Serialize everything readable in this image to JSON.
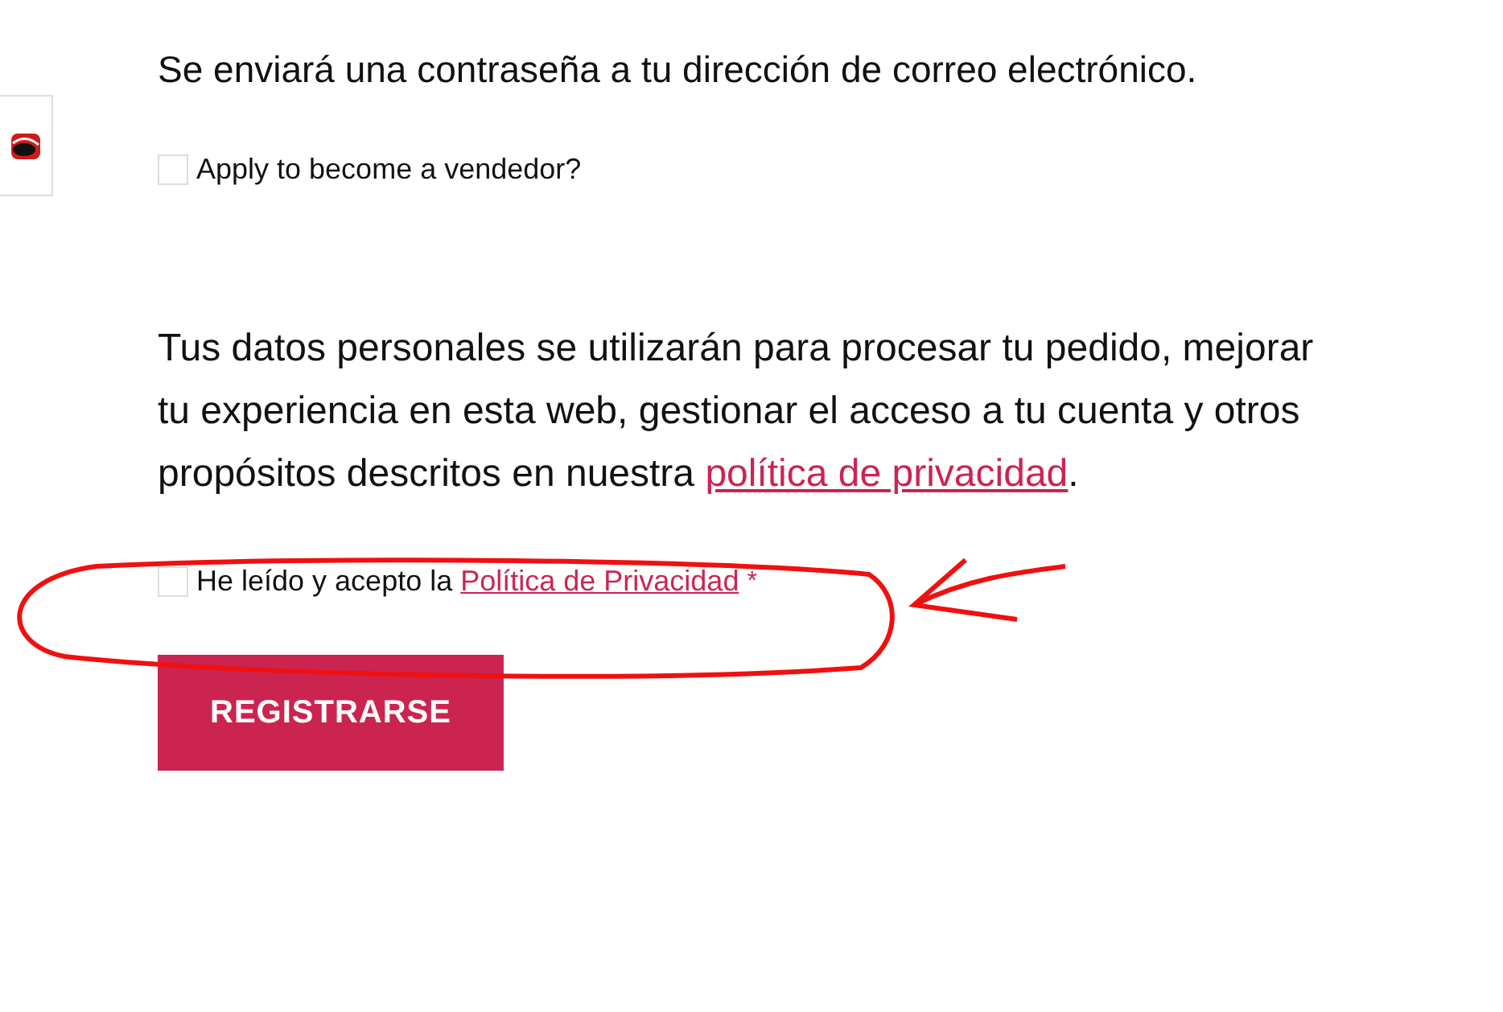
{
  "password_note": "Se enviará una contraseña a tu dirección de correo electrónico.",
  "vendor_option": {
    "label": "Apply to become a vendedor?",
    "checked": false
  },
  "privacy_notice": {
    "text": "Tus datos personales se utilizarán para procesar tu pedido, mejorar tu experiencia en esta web, gestionar el acceso a tu cuenta y otros propósitos descritos en nuestra",
    "link": "política de privacidad",
    "end": "."
  },
  "consent_option": {
    "label": "He leído y acepto la",
    "link": "Política de Privacidad",
    "required_mark": "*",
    "checked": false
  },
  "submit_button": "REGISTRARSE"
}
